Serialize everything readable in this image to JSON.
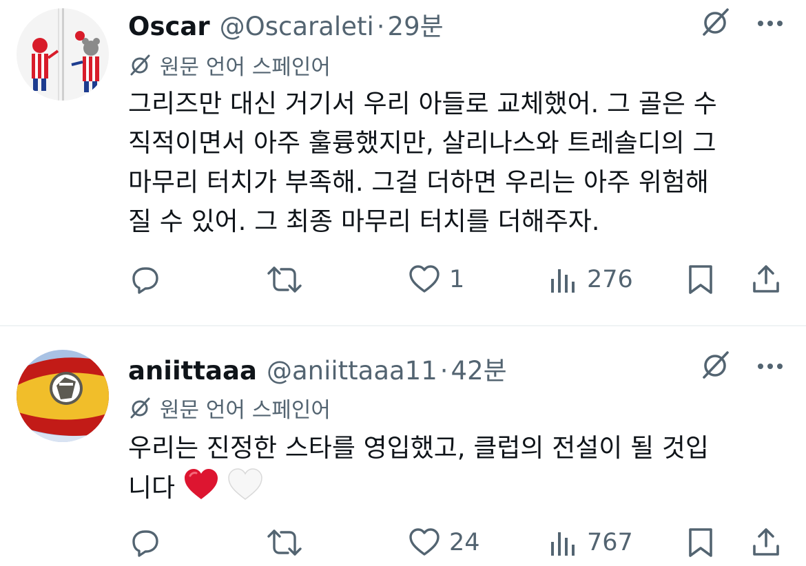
{
  "colors": {
    "text_primary": "#0f1419",
    "text_secondary": "#536471",
    "divider": "#eff3f4",
    "heart_red": "#dd1530"
  },
  "tweets": [
    {
      "display_name": "Oscar",
      "handle": "@Oscaraleti",
      "separator": "·",
      "time": "29분",
      "translate_label": "원문 언어 스페인어",
      "body_lines": [
        "그리즈만 대신 거기서 우리 아들로 교체했어. 그 골은 수",
        "직적이면서 아주 훌륭했지만, 살리나스와 트레솔디의 그",
        "마무리 터치가 부족해. 그걸 더하면 우리는 아주 위험해",
        "질 수 있어. 그 최종 마무리 터치를 더해주자."
      ],
      "reply_count": "",
      "retweet_count": "",
      "like_count": "1",
      "view_count": "276",
      "icons": [
        "grok-icon",
        "more-icon",
        "translate-icon",
        "reply-icon",
        "retweet-icon",
        "like-icon",
        "views-icon",
        "bookmark-icon",
        "share-icon"
      ]
    },
    {
      "display_name": "aniittaaa",
      "handle": "@aniittaaa11",
      "separator": "·",
      "time": "42분",
      "translate_label": "원문 언어 스페인어",
      "body_lines": [
        "우리는 진정한 스타를 영입했고, 클럽의 전설이 될 것입",
        "니다"
      ],
      "body_emojis": [
        "red-heart-emoji",
        "white-heart-emoji"
      ],
      "reply_count": "",
      "retweet_count": "",
      "like_count": "24",
      "view_count": "767",
      "icons": [
        "grok-icon",
        "more-icon",
        "translate-icon",
        "reply-icon",
        "retweet-icon",
        "like-icon",
        "views-icon",
        "bookmark-icon",
        "share-icon"
      ]
    }
  ]
}
